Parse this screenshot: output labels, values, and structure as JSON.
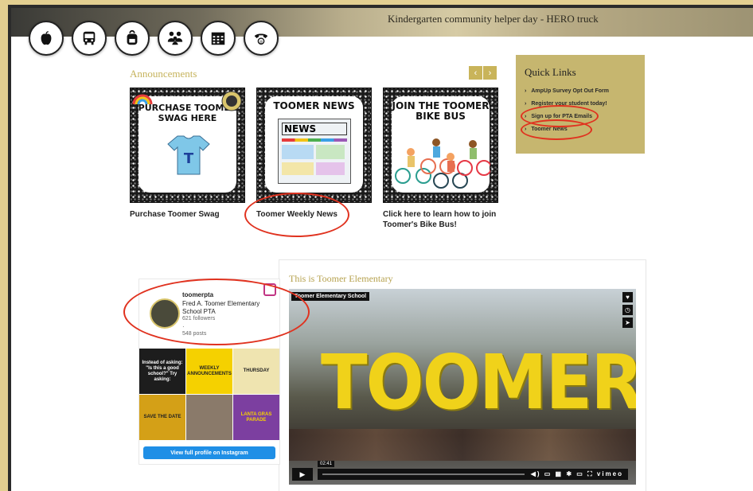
{
  "hero": {
    "caption": "Kindergarten community helper day - HERO truck"
  },
  "icon_bar": [
    "apple-icon",
    "bus-icon",
    "backpack-icon",
    "family-icon",
    "calendar-icon",
    "phone-icon"
  ],
  "announcements": {
    "title": "Announcements",
    "prev": "‹",
    "next": "›",
    "cards": [
      {
        "heading": "PURCHASE TOOMER SWAG HERE",
        "label": "Purchase Toomer Swag"
      },
      {
        "heading": "TOOMER NEWS",
        "screen_text": "NEWS",
        "label": "Toomer Weekly News"
      },
      {
        "heading": "JOIN THE TOOMER BIKE BUS",
        "label": "Click here to learn how to join Toomer's Bike Bus!"
      }
    ]
  },
  "quick_links": {
    "title": "Quick Links",
    "items": [
      "AmpUp Survey Opt Out Form",
      "Register your student today!",
      "Sign up for PTA Emails",
      "Toomer News"
    ]
  },
  "instagram": {
    "handle": "toomerpta",
    "name": "Fred A. Toomer Elementary School PTA",
    "followers": "621 followers",
    "dot": "·",
    "posts": "548 posts",
    "tiles": [
      "Instead of asking: \"Is this a good school?\" Try asking:",
      "WEEKLY ANNOUNCEMENTS",
      "THURSDAY",
      "SAVE THE DATE",
      "",
      "LANTA GRAS PARADE"
    ],
    "button": "View full profile on Instagram"
  },
  "video_section": {
    "title": "This is Toomer Elementary",
    "channel": "Toomer Elementary School",
    "banner_text": "TOOMER",
    "time": "02:41",
    "brand": "vimeo"
  },
  "colors": {
    "accent": "#c6b66f",
    "annotation": "#e0321f",
    "background": "#e3cf91",
    "instagram_button": "#1f8fe6"
  }
}
